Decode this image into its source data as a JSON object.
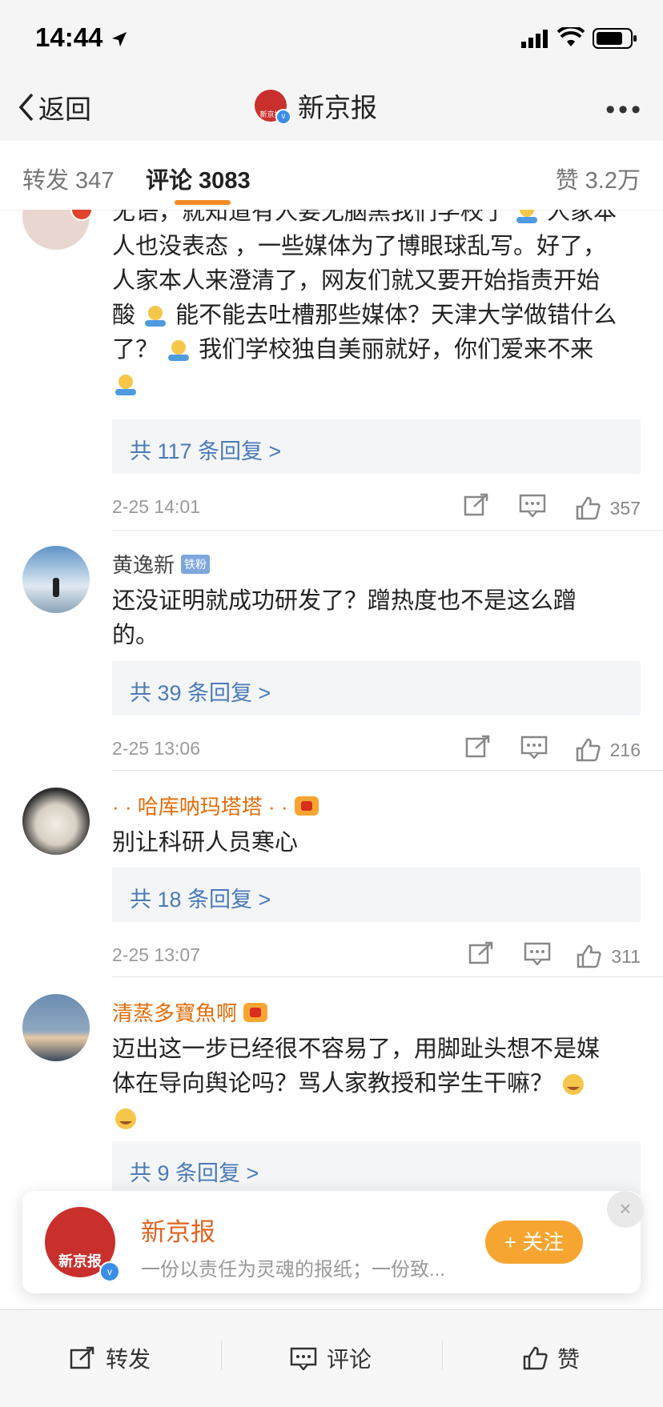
{
  "status_bar": {
    "time": "14:44"
  },
  "nav": {
    "back_label": "返回",
    "title": "新京报",
    "logo_text": "新京报",
    "more": "•••"
  },
  "tabs": [
    {
      "label": "转发 347"
    },
    {
      "label": "评论 3083"
    },
    {
      "label": "赞 3.2万"
    }
  ],
  "comments": [
    {
      "text_lines": [
        "无语，就知道有人要无脑黑我们学校了",
        "人家本",
        "人也没表态 ，一些媒体为了博眼球乱写。好了，",
        "人家本人来澄清了，网友们就又要开始指责开始",
        "酸",
        "能不能去吐槽那些媒体？天津大学做错什么",
        "了？",
        "我们学校独自美丽就好，你们爱来不来"
      ],
      "reply": "共 117 条回复 >",
      "date": "2-25 14:01",
      "likes": "357"
    },
    {
      "user": "黄逸新",
      "badge": "铁粉",
      "text_lines": [
        "还没证明就成功研发了？蹭热度也不是这么蹭",
        "的。"
      ],
      "reply": "共 39 条回复 >",
      "date": "2-25 13:06",
      "likes": "216"
    },
    {
      "user": "· · 哈库呐玛塔塔 · ·",
      "text_lines": [
        "别让科研人员寒心"
      ],
      "reply": "共 18 条回复 >",
      "date": "2-25 13:07",
      "likes": "311"
    },
    {
      "user": "清蒸多寶魚啊",
      "text_lines": [
        "迈出这一步已经很不容易了，用脚趾头想不是媒",
        "体在导向舆论吗？骂人家教授和学生干嘛？"
      ],
      "reply": "共 9 条回复 >"
    }
  ],
  "popup": {
    "name": "新京报",
    "logo_text": "新京报",
    "desc": "一份以责任为灵魂的报纸；一份致...",
    "follow": "+ 关注",
    "close": "×"
  },
  "bottom_bar": {
    "repost": "转发",
    "comment": "评论",
    "like": "赞"
  },
  "colors": {
    "accent": "#f08a24",
    "vip_name": "#e36c0a",
    "link": "#4a7ab8",
    "brand_red": "#c9302c"
  }
}
